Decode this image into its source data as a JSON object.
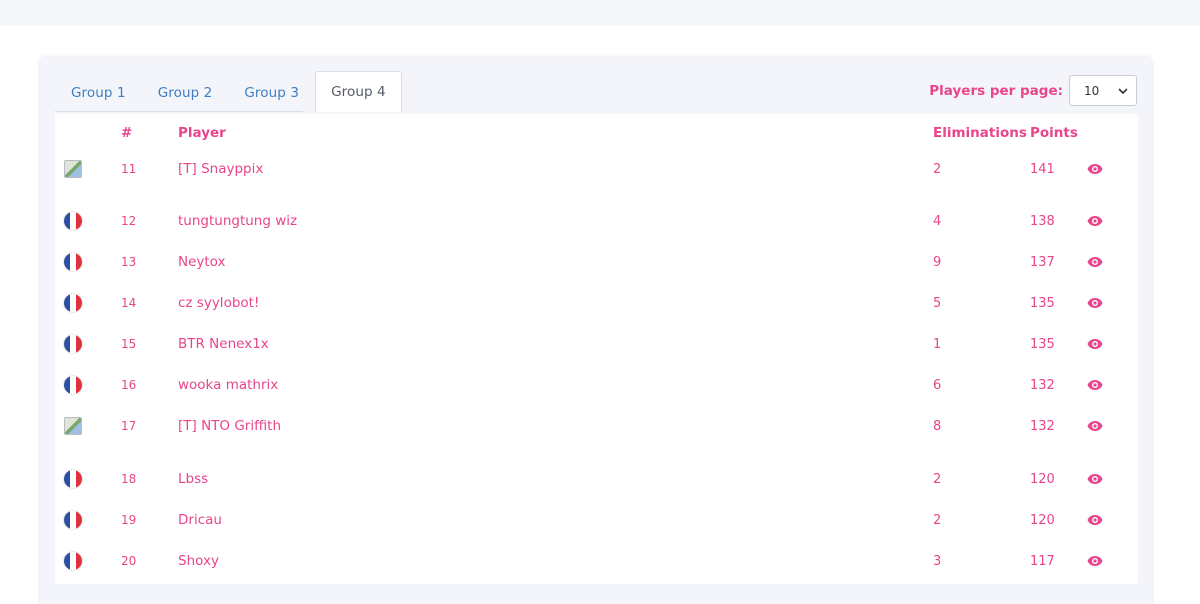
{
  "tabs": [
    {
      "label": "Group 1"
    },
    {
      "label": "Group 2"
    },
    {
      "label": "Group 3"
    },
    {
      "label": "Group 4"
    }
  ],
  "active_tab": "Group 4",
  "players_per_page": {
    "label": "Players per page:",
    "value": "10"
  },
  "table": {
    "headers": {
      "rank": "#",
      "player": "Player",
      "eliminations": "Eliminations",
      "points": "Points"
    },
    "rows": [
      {
        "flag": "broken-image",
        "rank": "11",
        "player": "[T] Snayppix",
        "eliminations": "2",
        "points": "141"
      },
      {
        "flag": "fr",
        "rank": "12",
        "player": "tungtungtung wiz",
        "eliminations": "4",
        "points": "138"
      },
      {
        "flag": "fr",
        "rank": "13",
        "player": "Neytox",
        "eliminations": "9",
        "points": "137"
      },
      {
        "flag": "fr",
        "rank": "14",
        "player": "cz syylobot!",
        "eliminations": "5",
        "points": "135"
      },
      {
        "flag": "fr",
        "rank": "15",
        "player": "BTR Nenex1x",
        "eliminations": "1",
        "points": "135"
      },
      {
        "flag": "fr",
        "rank": "16",
        "player": "wooka mathrix",
        "eliminations": "6",
        "points": "132"
      },
      {
        "flag": "broken-image",
        "rank": "17",
        "player": "[T] NTO Griffith",
        "eliminations": "8",
        "points": "132"
      },
      {
        "flag": "fr",
        "rank": "18",
        "player": "Lbss",
        "eliminations": "2",
        "points": "120"
      },
      {
        "flag": "fr",
        "rank": "19",
        "player": "Dricau",
        "eliminations": "2",
        "points": "120"
      },
      {
        "flag": "fr",
        "rank": "20",
        "player": "Shoxy",
        "eliminations": "3",
        "points": "117"
      }
    ]
  },
  "colors": {
    "accent": "#e8458b",
    "tab_link": "#3d7ec2",
    "page_bg": "#f4f5fa"
  },
  "icons": {
    "view": "eye-icon",
    "select": "chevron-down-icon"
  }
}
